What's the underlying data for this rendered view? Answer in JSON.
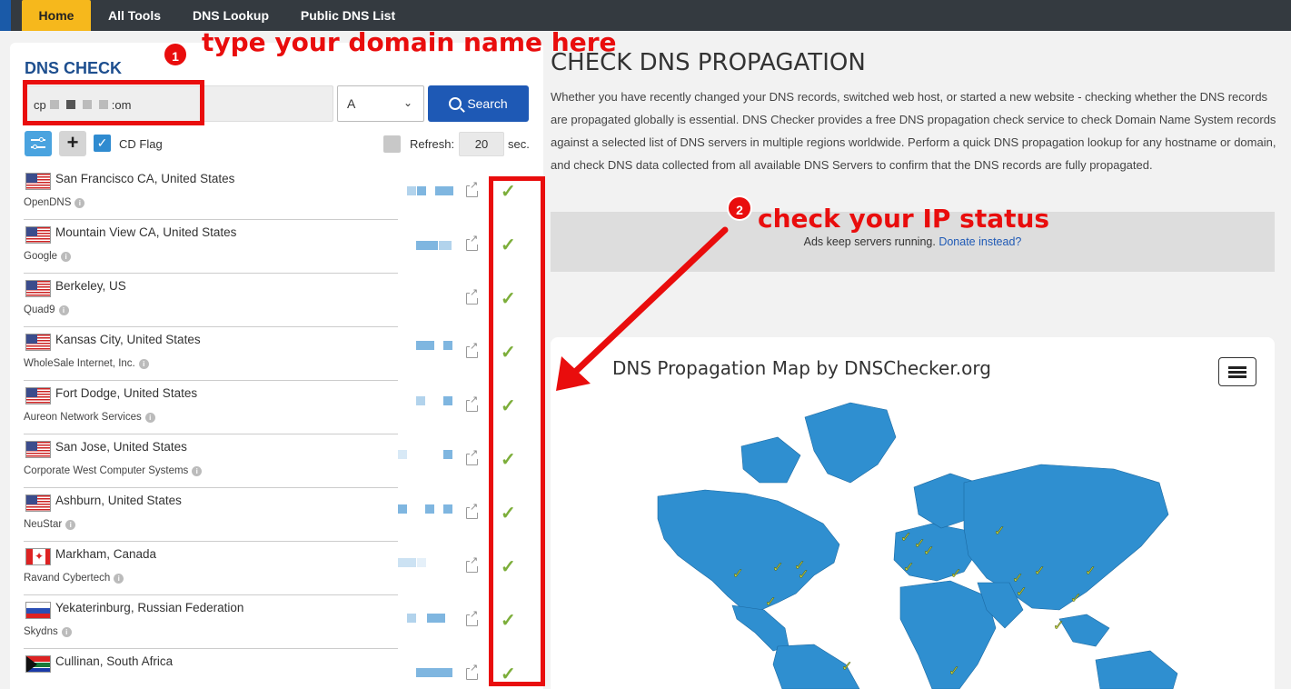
{
  "nav": {
    "tabs": [
      {
        "label": "Home",
        "active": true
      },
      {
        "label": "All Tools",
        "active": false
      },
      {
        "label": "DNS Lookup",
        "active": false
      },
      {
        "label": "Public DNS List",
        "active": false
      }
    ]
  },
  "dns_check": {
    "title": "DNS CHECK",
    "domain_value_prefix": "cp",
    "domain_value_suffix": ":om",
    "record_type": "A",
    "search_label": "Search",
    "cd_flag_label": "CD Flag",
    "cd_flag_checked": true,
    "refresh_label": "Refresh:",
    "refresh_value": "20",
    "refresh_unit": "sec."
  },
  "servers": [
    {
      "location": "San Francisco CA, United States",
      "provider": "OpenDNS",
      "flag": "us",
      "status": "ok"
    },
    {
      "location": "Mountain View CA, United States",
      "provider": "Google",
      "flag": "us",
      "status": "ok"
    },
    {
      "location": "Berkeley, US",
      "provider": "Quad9",
      "flag": "us",
      "status": "ok"
    },
    {
      "location": "Kansas City, United States",
      "provider": "WholeSale Internet, Inc.",
      "flag": "us",
      "status": "ok"
    },
    {
      "location": "Fort Dodge, United States",
      "provider": "Aureon Network Services",
      "flag": "us",
      "status": "ok"
    },
    {
      "location": "San Jose, United States",
      "provider": "Corporate West Computer Systems",
      "flag": "us",
      "status": "ok"
    },
    {
      "location": "Ashburn, United States",
      "provider": "NeuStar",
      "flag": "us",
      "status": "ok"
    },
    {
      "location": "Markham, Canada",
      "provider": "Ravand Cybertech",
      "flag": "ca",
      "status": "ok"
    },
    {
      "location": "Yekaterinburg, Russian Federation",
      "provider": "Skydns",
      "flag": "ru",
      "status": "ok"
    },
    {
      "location": "Cullinan, South Africa",
      "provider": "",
      "flag": "za",
      "status": "ok"
    }
  ],
  "annotations": {
    "step1_number": "1",
    "step1_text": "type your domain name here",
    "step2_number": "2",
    "step2_text": "check your IP status"
  },
  "main": {
    "title": "CHECK DNS PROPAGATION",
    "description": "Whether you have recently changed your DNS records, switched web host, or started a new website - checking whether the DNS records are propagated globally is essential. DNS Checker provides a free DNS propagation check service to check Domain Name System records against a selected list of DNS servers in multiple regions worldwide. Perform a quick DNS propagation lookup for any hostname or domain, and check DNS data collected from all available DNS Servers to confirm that the DNS records are fully propagated.",
    "ad_text": "Ads keep servers running.",
    "ad_link": "Donate instead?",
    "map_title": "DNS Propagation Map by DNSChecker.org"
  },
  "colors": {
    "accent": "#f6b81c",
    "nav_bg": "#343a40",
    "primary": "#1e59b5",
    "check_green": "#7cae3a",
    "annotation_red": "#e90d0d",
    "map_land": "#2f8fd0"
  }
}
